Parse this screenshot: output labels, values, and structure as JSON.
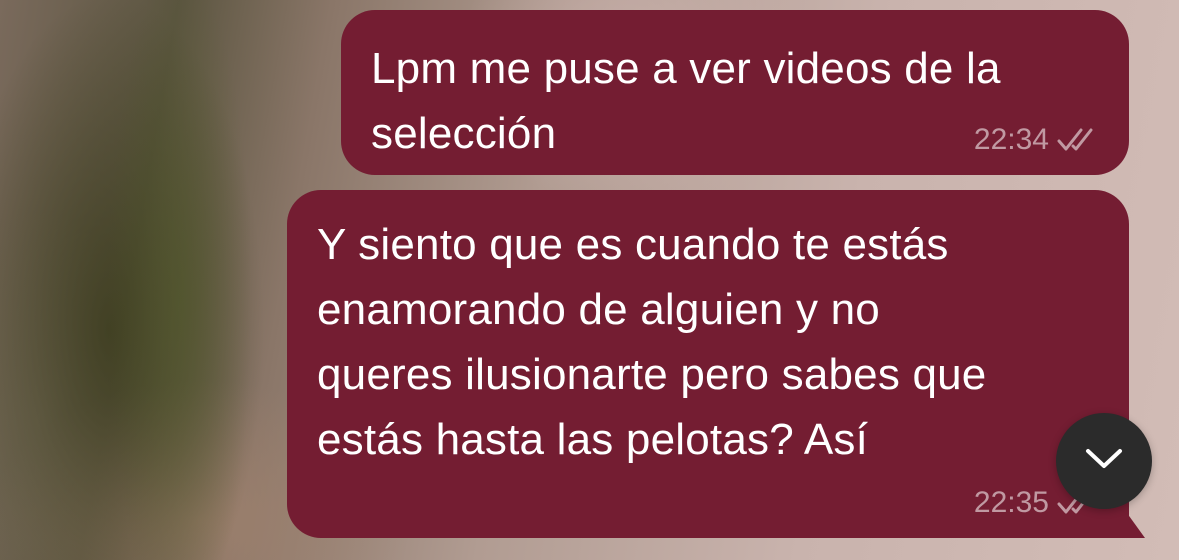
{
  "messages": [
    {
      "text": "Lpm me puse a ver videos de la\nselección",
      "time": "22:34",
      "status_icon": "double-check-icon"
    },
    {
      "text": "Y siento que es cuando te estás\nenamorando de alguien y no\nqueres ilusionarte pero sabes que\nestás hasta las pelotas? Así",
      "time": "22:35",
      "status_icon": "double-check-icon"
    }
  ],
  "scroll_button": {
    "icon": "chevron-down-icon"
  },
  "colors": {
    "outgoing_bubble": "#741d32",
    "scroll_button_bg": "#2b2b2b"
  }
}
